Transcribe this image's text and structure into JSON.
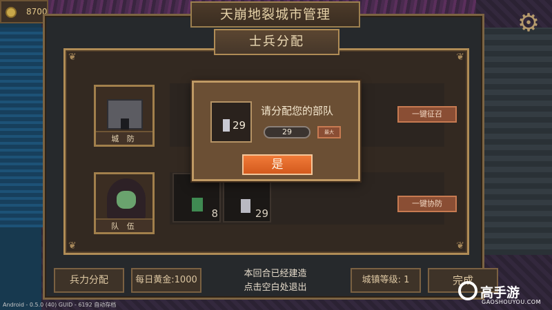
{
  "hud": {
    "gold": "8700"
  },
  "window": {
    "title": "天崩地裂城市管理"
  },
  "panel": {
    "title": "士兵分配",
    "rows": [
      {
        "label": "城 防",
        "button": "一键征召"
      },
      {
        "label": "队 伍",
        "button": "一键协防"
      }
    ],
    "units": [
      {
        "count": "8"
      },
      {
        "count": "29"
      }
    ]
  },
  "modal": {
    "prompt": "请分配您的部队",
    "unit_count": "29",
    "amount": "29",
    "max_label": "最大",
    "confirm_label": "是"
  },
  "bottom": {
    "allocate_label": "兵力分配",
    "daily_gold": "每日黄金:1000",
    "status_line1": "本回合已经建造",
    "status_line2": "点击空白处退出",
    "town_level": "城镇等级: 1",
    "done_label": "完成"
  },
  "footer": {
    "version": "Android - 0.5.0 (40)   GUID - 6192   自动存档"
  },
  "brand": {
    "name": "高手游",
    "url": "GAOSHOUYOU.COM"
  }
}
